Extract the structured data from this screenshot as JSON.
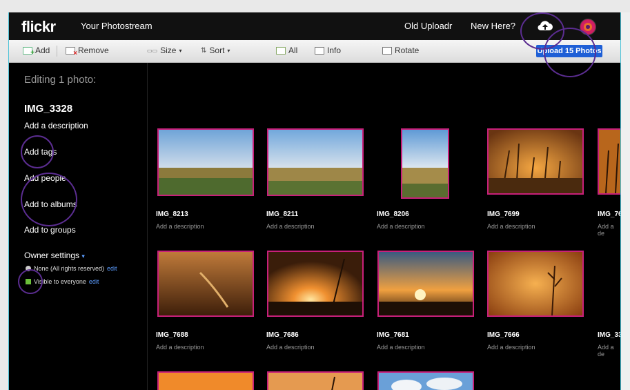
{
  "topbar": {
    "logo": "flickr",
    "nav": {
      "photostream": "Your Photostream",
      "old_uploadr": "Old Uploadr",
      "new_here": "New Here?"
    }
  },
  "toolbar": {
    "add": "Add",
    "remove": "Remove",
    "size": "Size",
    "sort": "Sort",
    "all": "All",
    "info": "Info",
    "rotate": "Rotate",
    "upload": "Upload 15 Photos"
  },
  "left_panel": {
    "heading": "Editing 1 photo:",
    "photo_title": "IMG_3328",
    "add_description": "Add a description",
    "add_tags": "Add tags",
    "add_people": "Add people",
    "add_albums": "Add to albums",
    "add_groups": "Add to groups",
    "owner_settings": "Owner settings",
    "license": "None (All rights reserved)",
    "visibility": "Visible to everyone",
    "edit": "edit"
  },
  "photos": [
    {
      "title": "IMG_8213",
      "desc": "Add a description"
    },
    {
      "title": "IMG_8211",
      "desc": "Add a description"
    },
    {
      "title": "IMG_8206",
      "desc": "Add a description"
    },
    {
      "title": "IMG_7699",
      "desc": "Add a description"
    },
    {
      "title": "IMG_76",
      "desc": "Add a de"
    },
    {
      "title": "IMG_7688",
      "desc": "Add a description"
    },
    {
      "title": "IMG_7686",
      "desc": "Add a description"
    },
    {
      "title": "IMG_7681",
      "desc": "Add a description"
    },
    {
      "title": "IMG_7666",
      "desc": "Add a description"
    },
    {
      "title": "IMG_33",
      "desc": "Add a de"
    }
  ],
  "colors": {
    "accent_blue": "#1e5fd6",
    "selection_border": "#c8207a",
    "annotation_ring": "#5b2d91"
  }
}
